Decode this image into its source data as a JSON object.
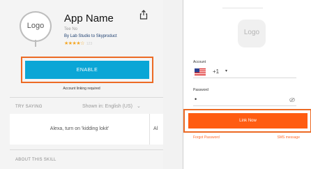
{
  "left": {
    "logo_text": "Logo",
    "app_name": "App Name",
    "app_subtitle": "Tee No",
    "developer": "By Lab Studio to Skyproduct",
    "rating_stars": "★★★★☆",
    "rating_count": "123",
    "enable_label": "ENABLE",
    "account_required": "Account linking required",
    "try_saying_label": "TRY SAYING",
    "language_value": "Shown in: English (US)",
    "sample_utterance": "Alexa, turn on 'kidding lokit'",
    "sample_utterance_2": "Al",
    "about_label": "ABOUT THIS SKILL"
  },
  "right": {
    "logo_text": "Logo",
    "account_label": "Account",
    "country_code": "+1",
    "password_label": "Password",
    "password_mask": "•",
    "link_now_label": "Link Now",
    "forgot_password": "Forgot Password",
    "sms_message": "SMS message"
  },
  "colors": {
    "highlight_border": "#ec6a24",
    "enable_button": "#0aa6d6",
    "link_button": "#ff5c12",
    "link_text": "#ff6a2a"
  },
  "icons": {
    "share": "share-icon",
    "flag": "us-flag-icon",
    "dropdown": "chevron-down-icon",
    "eye": "eye-slash-icon"
  }
}
